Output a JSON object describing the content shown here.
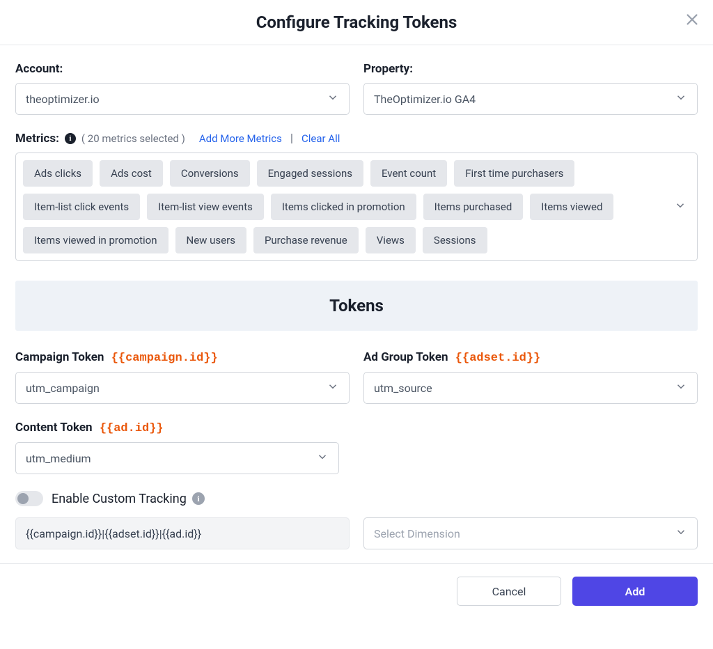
{
  "header": {
    "title": "Configure Tracking Tokens"
  },
  "account": {
    "label": "Account:",
    "value": "theoptimizer.io"
  },
  "property": {
    "label": "Property:",
    "value": "TheOptimizer.io GA4"
  },
  "metrics": {
    "label": "Metrics:",
    "count_text": "( 20 metrics selected )",
    "add_more": "Add More Metrics",
    "clear_all": "Clear All",
    "chips": [
      "Ads clicks",
      "Ads cost",
      "Conversions",
      "Engaged sessions",
      "Event count",
      "First time purchasers",
      "Item-list click events",
      "Item-list view events",
      "Items clicked in promotion",
      "Items purchased",
      "Items viewed",
      "Items viewed in promotion",
      "New users",
      "Purchase revenue",
      "Views",
      "Sessions"
    ]
  },
  "tokens": {
    "banner": "Tokens",
    "campaign": {
      "label": "Campaign Token",
      "hint": "{{campaign.id}}",
      "value": "utm_campaign"
    },
    "adgroup": {
      "label": "Ad Group Token",
      "hint": "{{adset.id}}",
      "value": "utm_source"
    },
    "content": {
      "label": "Content Token",
      "hint": "{{ad.id}}",
      "value": "utm_medium"
    }
  },
  "custom_tracking": {
    "label": "Enable Custom Tracking",
    "template_value": "{{campaign.id}}|{{adset.id}}|{{ad.id}}",
    "dimension_placeholder": "Select Dimension"
  },
  "footer": {
    "cancel": "Cancel",
    "add": "Add"
  }
}
